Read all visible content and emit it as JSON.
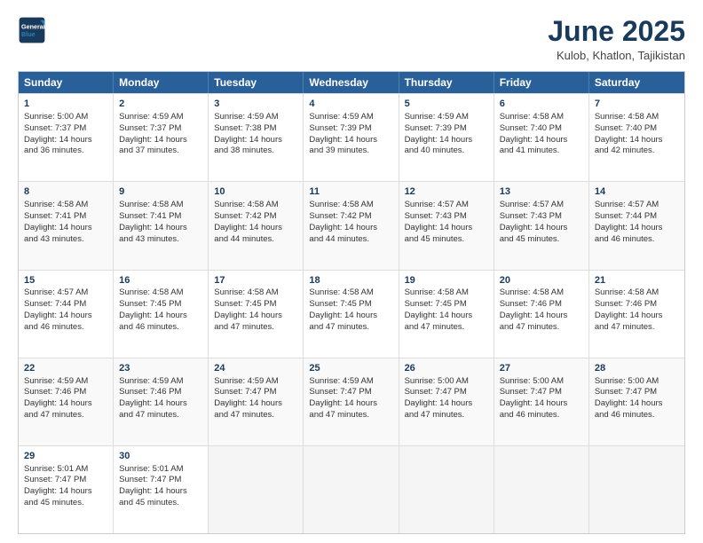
{
  "logo": {
    "text_general": "General",
    "text_blue": "Blue"
  },
  "title": "June 2025",
  "location": "Kulob, Khatlon, Tajikistan",
  "header_days": [
    "Sunday",
    "Monday",
    "Tuesday",
    "Wednesday",
    "Thursday",
    "Friday",
    "Saturday"
  ],
  "weeks": [
    [
      {
        "day": 1,
        "lines": [
          "Sunrise: 5:00 AM",
          "Sunset: 7:37 PM",
          "Daylight: 14 hours",
          "and 36 minutes."
        ]
      },
      {
        "day": 2,
        "lines": [
          "Sunrise: 4:59 AM",
          "Sunset: 7:37 PM",
          "Daylight: 14 hours",
          "and 37 minutes."
        ]
      },
      {
        "day": 3,
        "lines": [
          "Sunrise: 4:59 AM",
          "Sunset: 7:38 PM",
          "Daylight: 14 hours",
          "and 38 minutes."
        ]
      },
      {
        "day": 4,
        "lines": [
          "Sunrise: 4:59 AM",
          "Sunset: 7:39 PM",
          "Daylight: 14 hours",
          "and 39 minutes."
        ]
      },
      {
        "day": 5,
        "lines": [
          "Sunrise: 4:59 AM",
          "Sunset: 7:39 PM",
          "Daylight: 14 hours",
          "and 40 minutes."
        ]
      },
      {
        "day": 6,
        "lines": [
          "Sunrise: 4:58 AM",
          "Sunset: 7:40 PM",
          "Daylight: 14 hours",
          "and 41 minutes."
        ]
      },
      {
        "day": 7,
        "lines": [
          "Sunrise: 4:58 AM",
          "Sunset: 7:40 PM",
          "Daylight: 14 hours",
          "and 42 minutes."
        ]
      }
    ],
    [
      {
        "day": 8,
        "lines": [
          "Sunrise: 4:58 AM",
          "Sunset: 7:41 PM",
          "Daylight: 14 hours",
          "and 43 minutes."
        ]
      },
      {
        "day": 9,
        "lines": [
          "Sunrise: 4:58 AM",
          "Sunset: 7:41 PM",
          "Daylight: 14 hours",
          "and 43 minutes."
        ]
      },
      {
        "day": 10,
        "lines": [
          "Sunrise: 4:58 AM",
          "Sunset: 7:42 PM",
          "Daylight: 14 hours",
          "and 44 minutes."
        ]
      },
      {
        "day": 11,
        "lines": [
          "Sunrise: 4:58 AM",
          "Sunset: 7:42 PM",
          "Daylight: 14 hours",
          "and 44 minutes."
        ]
      },
      {
        "day": 12,
        "lines": [
          "Sunrise: 4:57 AM",
          "Sunset: 7:43 PM",
          "Daylight: 14 hours",
          "and 45 minutes."
        ]
      },
      {
        "day": 13,
        "lines": [
          "Sunrise: 4:57 AM",
          "Sunset: 7:43 PM",
          "Daylight: 14 hours",
          "and 45 minutes."
        ]
      },
      {
        "day": 14,
        "lines": [
          "Sunrise: 4:57 AM",
          "Sunset: 7:44 PM",
          "Daylight: 14 hours",
          "and 46 minutes."
        ]
      }
    ],
    [
      {
        "day": 15,
        "lines": [
          "Sunrise: 4:57 AM",
          "Sunset: 7:44 PM",
          "Daylight: 14 hours",
          "and 46 minutes."
        ]
      },
      {
        "day": 16,
        "lines": [
          "Sunrise: 4:58 AM",
          "Sunset: 7:45 PM",
          "Daylight: 14 hours",
          "and 46 minutes."
        ]
      },
      {
        "day": 17,
        "lines": [
          "Sunrise: 4:58 AM",
          "Sunset: 7:45 PM",
          "Daylight: 14 hours",
          "and 47 minutes."
        ]
      },
      {
        "day": 18,
        "lines": [
          "Sunrise: 4:58 AM",
          "Sunset: 7:45 PM",
          "Daylight: 14 hours",
          "and 47 minutes."
        ]
      },
      {
        "day": 19,
        "lines": [
          "Sunrise: 4:58 AM",
          "Sunset: 7:45 PM",
          "Daylight: 14 hours",
          "and 47 minutes."
        ]
      },
      {
        "day": 20,
        "lines": [
          "Sunrise: 4:58 AM",
          "Sunset: 7:46 PM",
          "Daylight: 14 hours",
          "and 47 minutes."
        ]
      },
      {
        "day": 21,
        "lines": [
          "Sunrise: 4:58 AM",
          "Sunset: 7:46 PM",
          "Daylight: 14 hours",
          "and 47 minutes."
        ]
      }
    ],
    [
      {
        "day": 22,
        "lines": [
          "Sunrise: 4:59 AM",
          "Sunset: 7:46 PM",
          "Daylight: 14 hours",
          "and 47 minutes."
        ]
      },
      {
        "day": 23,
        "lines": [
          "Sunrise: 4:59 AM",
          "Sunset: 7:46 PM",
          "Daylight: 14 hours",
          "and 47 minutes."
        ]
      },
      {
        "day": 24,
        "lines": [
          "Sunrise: 4:59 AM",
          "Sunset: 7:47 PM",
          "Daylight: 14 hours",
          "and 47 minutes."
        ]
      },
      {
        "day": 25,
        "lines": [
          "Sunrise: 4:59 AM",
          "Sunset: 7:47 PM",
          "Daylight: 14 hours",
          "and 47 minutes."
        ]
      },
      {
        "day": 26,
        "lines": [
          "Sunrise: 5:00 AM",
          "Sunset: 7:47 PM",
          "Daylight: 14 hours",
          "and 47 minutes."
        ]
      },
      {
        "day": 27,
        "lines": [
          "Sunrise: 5:00 AM",
          "Sunset: 7:47 PM",
          "Daylight: 14 hours",
          "and 46 minutes."
        ]
      },
      {
        "day": 28,
        "lines": [
          "Sunrise: 5:00 AM",
          "Sunset: 7:47 PM",
          "Daylight: 14 hours",
          "and 46 minutes."
        ]
      }
    ],
    [
      {
        "day": 29,
        "lines": [
          "Sunrise: 5:01 AM",
          "Sunset: 7:47 PM",
          "Daylight: 14 hours",
          "and 45 minutes."
        ]
      },
      {
        "day": 30,
        "lines": [
          "Sunrise: 5:01 AM",
          "Sunset: 7:47 PM",
          "Daylight: 14 hours",
          "and 45 minutes."
        ]
      },
      null,
      null,
      null,
      null,
      null
    ]
  ]
}
